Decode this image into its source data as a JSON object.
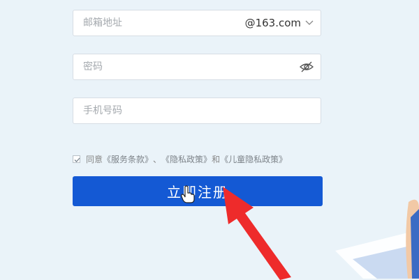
{
  "form": {
    "email": {
      "placeholder": "邮箱地址",
      "domain": "@163.com"
    },
    "password": {
      "placeholder": "密码"
    },
    "phone": {
      "placeholder": "手机号码"
    },
    "agreement": {
      "prefix": "同意",
      "terms": "《服务条款》",
      "sep1": "、",
      "privacy": "《隐私政策》",
      "and": "和",
      "child_privacy": "《儿童隐私政策》"
    },
    "submit_label": "立即注册"
  },
  "colors": {
    "accent": "#1459d4",
    "background": "#eaf3f9",
    "pointer_arrow": "#ee2b2b"
  },
  "icons": {
    "domain_dropdown": "chevron-down-icon",
    "password_toggle": "eye-slash-icon",
    "cursor": "hand-pointer-icon",
    "overlay": "red-arrow"
  }
}
